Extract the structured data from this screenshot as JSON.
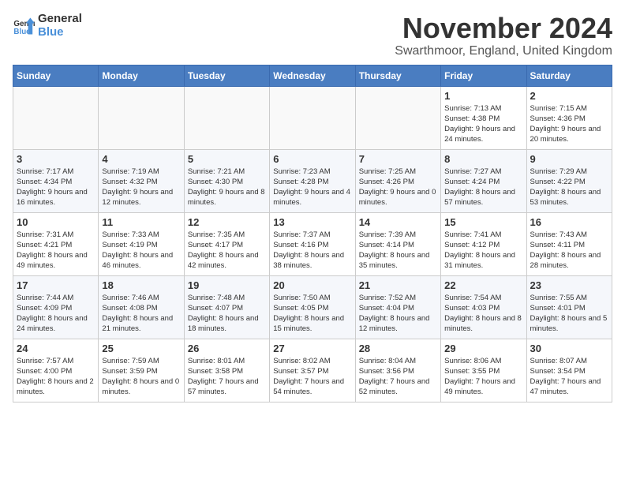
{
  "header": {
    "logo_line1": "General",
    "logo_line2": "Blue",
    "title": "November 2024",
    "subtitle": "Swarthmoor, England, United Kingdom"
  },
  "weekdays": [
    "Sunday",
    "Monday",
    "Tuesday",
    "Wednesday",
    "Thursday",
    "Friday",
    "Saturday"
  ],
  "weeks": [
    [
      {
        "day": "",
        "info": ""
      },
      {
        "day": "",
        "info": ""
      },
      {
        "day": "",
        "info": ""
      },
      {
        "day": "",
        "info": ""
      },
      {
        "day": "",
        "info": ""
      },
      {
        "day": "1",
        "info": "Sunrise: 7:13 AM\nSunset: 4:38 PM\nDaylight: 9 hours and 24 minutes."
      },
      {
        "day": "2",
        "info": "Sunrise: 7:15 AM\nSunset: 4:36 PM\nDaylight: 9 hours and 20 minutes."
      }
    ],
    [
      {
        "day": "3",
        "info": "Sunrise: 7:17 AM\nSunset: 4:34 PM\nDaylight: 9 hours and 16 minutes."
      },
      {
        "day": "4",
        "info": "Sunrise: 7:19 AM\nSunset: 4:32 PM\nDaylight: 9 hours and 12 minutes."
      },
      {
        "day": "5",
        "info": "Sunrise: 7:21 AM\nSunset: 4:30 PM\nDaylight: 9 hours and 8 minutes."
      },
      {
        "day": "6",
        "info": "Sunrise: 7:23 AM\nSunset: 4:28 PM\nDaylight: 9 hours and 4 minutes."
      },
      {
        "day": "7",
        "info": "Sunrise: 7:25 AM\nSunset: 4:26 PM\nDaylight: 9 hours and 0 minutes."
      },
      {
        "day": "8",
        "info": "Sunrise: 7:27 AM\nSunset: 4:24 PM\nDaylight: 8 hours and 57 minutes."
      },
      {
        "day": "9",
        "info": "Sunrise: 7:29 AM\nSunset: 4:22 PM\nDaylight: 8 hours and 53 minutes."
      }
    ],
    [
      {
        "day": "10",
        "info": "Sunrise: 7:31 AM\nSunset: 4:21 PM\nDaylight: 8 hours and 49 minutes."
      },
      {
        "day": "11",
        "info": "Sunrise: 7:33 AM\nSunset: 4:19 PM\nDaylight: 8 hours and 46 minutes."
      },
      {
        "day": "12",
        "info": "Sunrise: 7:35 AM\nSunset: 4:17 PM\nDaylight: 8 hours and 42 minutes."
      },
      {
        "day": "13",
        "info": "Sunrise: 7:37 AM\nSunset: 4:16 PM\nDaylight: 8 hours and 38 minutes."
      },
      {
        "day": "14",
        "info": "Sunrise: 7:39 AM\nSunset: 4:14 PM\nDaylight: 8 hours and 35 minutes."
      },
      {
        "day": "15",
        "info": "Sunrise: 7:41 AM\nSunset: 4:12 PM\nDaylight: 8 hours and 31 minutes."
      },
      {
        "day": "16",
        "info": "Sunrise: 7:43 AM\nSunset: 4:11 PM\nDaylight: 8 hours and 28 minutes."
      }
    ],
    [
      {
        "day": "17",
        "info": "Sunrise: 7:44 AM\nSunset: 4:09 PM\nDaylight: 8 hours and 24 minutes."
      },
      {
        "day": "18",
        "info": "Sunrise: 7:46 AM\nSunset: 4:08 PM\nDaylight: 8 hours and 21 minutes."
      },
      {
        "day": "19",
        "info": "Sunrise: 7:48 AM\nSunset: 4:07 PM\nDaylight: 8 hours and 18 minutes."
      },
      {
        "day": "20",
        "info": "Sunrise: 7:50 AM\nSunset: 4:05 PM\nDaylight: 8 hours and 15 minutes."
      },
      {
        "day": "21",
        "info": "Sunrise: 7:52 AM\nSunset: 4:04 PM\nDaylight: 8 hours and 12 minutes."
      },
      {
        "day": "22",
        "info": "Sunrise: 7:54 AM\nSunset: 4:03 PM\nDaylight: 8 hours and 8 minutes."
      },
      {
        "day": "23",
        "info": "Sunrise: 7:55 AM\nSunset: 4:01 PM\nDaylight: 8 hours and 5 minutes."
      }
    ],
    [
      {
        "day": "24",
        "info": "Sunrise: 7:57 AM\nSunset: 4:00 PM\nDaylight: 8 hours and 2 minutes."
      },
      {
        "day": "25",
        "info": "Sunrise: 7:59 AM\nSunset: 3:59 PM\nDaylight: 8 hours and 0 minutes."
      },
      {
        "day": "26",
        "info": "Sunrise: 8:01 AM\nSunset: 3:58 PM\nDaylight: 7 hours and 57 minutes."
      },
      {
        "day": "27",
        "info": "Sunrise: 8:02 AM\nSunset: 3:57 PM\nDaylight: 7 hours and 54 minutes."
      },
      {
        "day": "28",
        "info": "Sunrise: 8:04 AM\nSunset: 3:56 PM\nDaylight: 7 hours and 52 minutes."
      },
      {
        "day": "29",
        "info": "Sunrise: 8:06 AM\nSunset: 3:55 PM\nDaylight: 7 hours and 49 minutes."
      },
      {
        "day": "30",
        "info": "Sunrise: 8:07 AM\nSunset: 3:54 PM\nDaylight: 7 hours and 47 minutes."
      }
    ]
  ]
}
